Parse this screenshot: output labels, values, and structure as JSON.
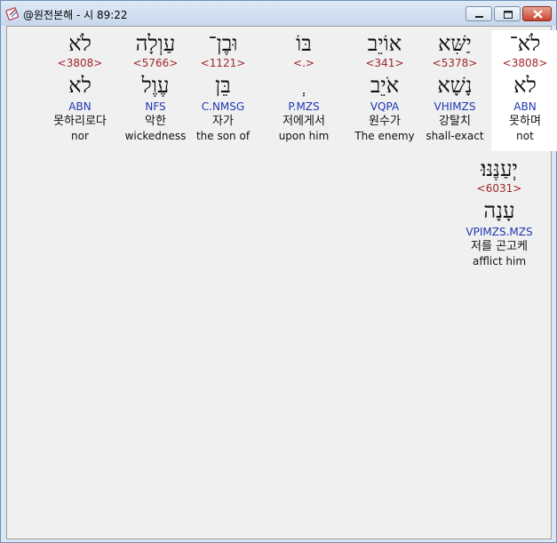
{
  "window": {
    "title": "@원전본해 - 시 89:22",
    "app_icon": "bible-app-icon"
  },
  "words_row1": [
    {
      "hebrew": "לֹא־",
      "strong": "<3808>",
      "lemma": "לא",
      "morph": "ABN",
      "korean": "못하며",
      "english": "not"
    },
    {
      "hebrew": "יַשִּׁא",
      "strong": "<5378>",
      "lemma": "נָשָׁא",
      "morph": "VHIMZS",
      "korean": "강탈치",
      "english": "shall-exact"
    },
    {
      "hebrew": "אוֹיֵב",
      "strong": "<341>",
      "lemma": "אֹיֵב",
      "morph": "VQPA",
      "korean": "원수가",
      "english": "The enemy"
    },
    {
      "hebrew": "בּוֹ",
      "strong": "<.>",
      "lemma": "ְ",
      "morph": "P.MZS",
      "korean": "저에게서",
      "english": "upon him"
    },
    {
      "hebrew": "וּבֶן־",
      "strong": "<1121>",
      "lemma": "בֵּן",
      "morph": "C.NMSG",
      "korean": "자가",
      "english": "the son of"
    },
    {
      "hebrew": "עַוְלָה",
      "strong": "<5766>",
      "lemma": "עֶוֶל",
      "morph": "NFS",
      "korean": "악한",
      "english": "wickedness"
    },
    {
      "hebrew": "לֹא",
      "strong": "<3808>",
      "lemma": "לא",
      "morph": "ABN",
      "korean": "못하리로다",
      "english": "nor"
    }
  ],
  "words_row2": [
    {
      "hebrew": "יְעַנֶּנּוּ׃",
      "strong": "<6031>",
      "lemma": "עָנָה",
      "morph": "VPIMZS.MZS",
      "korean": "저를 곤고케",
      "english": "afflict him"
    }
  ]
}
